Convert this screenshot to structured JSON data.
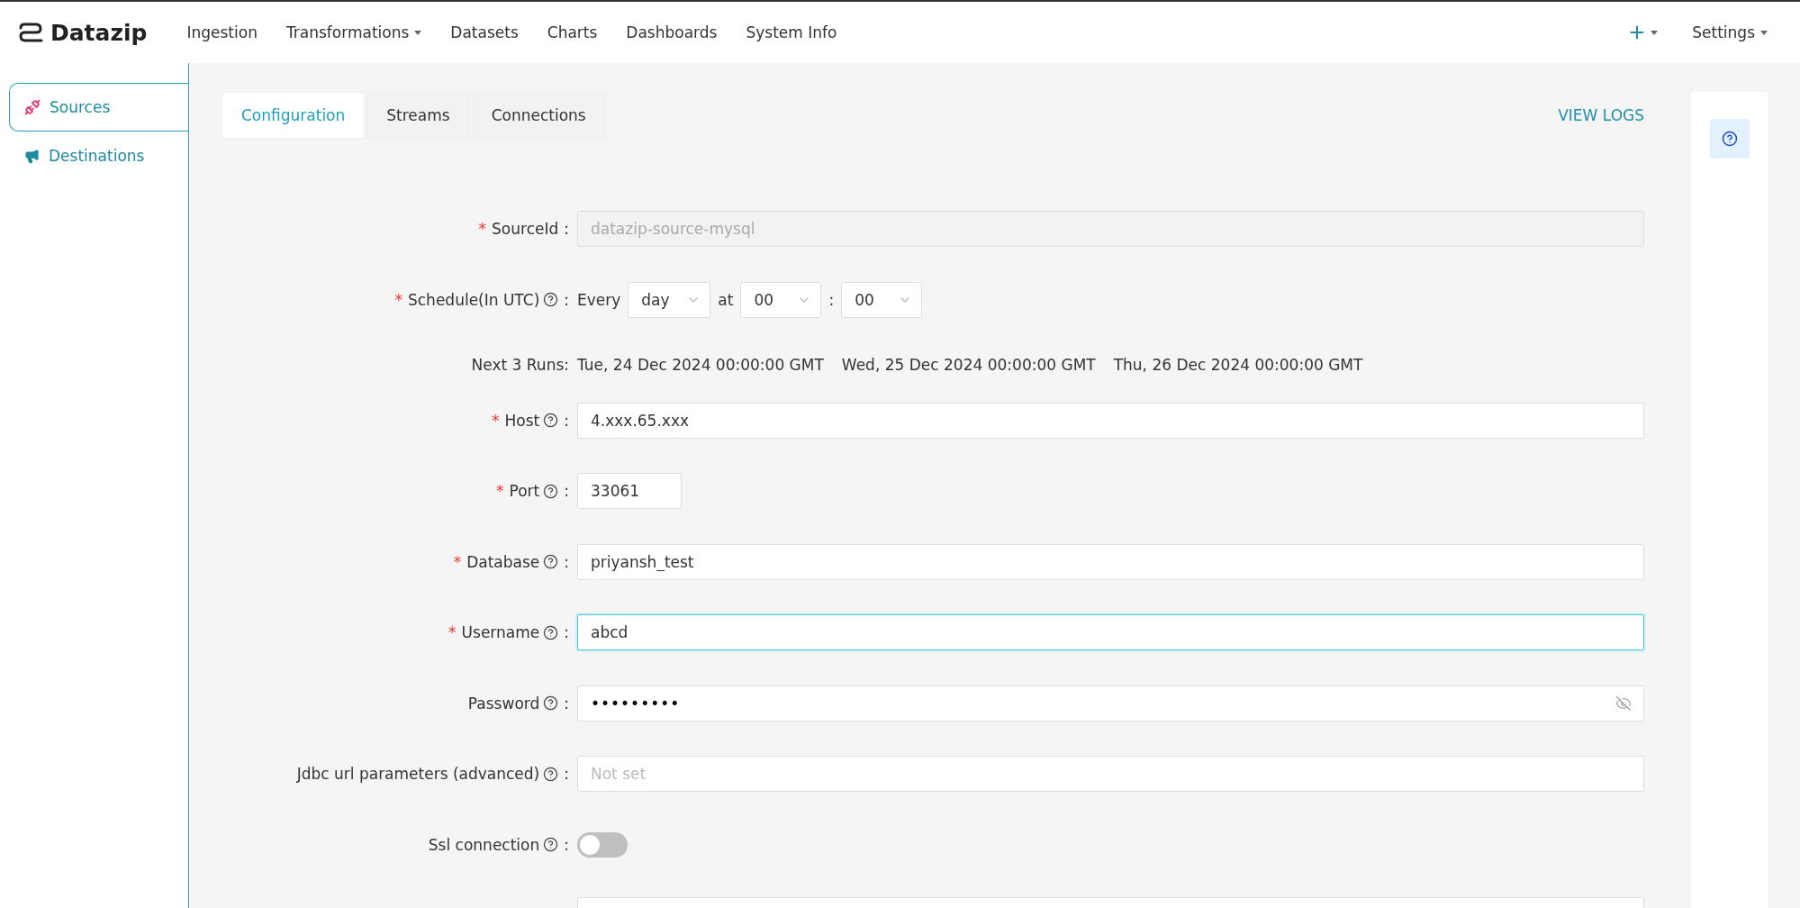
{
  "top_nav": {
    "brand": "Datazip",
    "items": [
      {
        "label": "Ingestion",
        "dropdown": false
      },
      {
        "label": "Transformations",
        "dropdown": true
      },
      {
        "label": "Datasets",
        "dropdown": false
      },
      {
        "label": "Charts",
        "dropdown": false
      },
      {
        "label": "Dashboards",
        "dropdown": false
      },
      {
        "label": "System Info",
        "dropdown": false
      }
    ],
    "settings": {
      "label": "Settings"
    }
  },
  "sidebar": {
    "items": [
      {
        "label": "Sources",
        "kind": "sources",
        "selected": true
      },
      {
        "label": "Destinations",
        "kind": "destinations",
        "selected": false
      }
    ]
  },
  "tabs": [
    {
      "label": "Configuration",
      "selected": true
    },
    {
      "label": "Streams",
      "selected": false
    },
    {
      "label": "Connections",
      "selected": false
    }
  ],
  "view_logs": "VIEW LOGS",
  "form": [
    {
      "kind": "text",
      "required_mark": "*",
      "label": "SourceId",
      "help": false,
      "colon": ":",
      "value": "datazip-source-mysql",
      "disabled": true
    },
    {
      "kind": "schedule",
      "required_mark": "*",
      "label": "Schedule(In UTC)",
      "help": true,
      "colon": ":",
      "every": "Every",
      "period": "day",
      "at": "at",
      "hour": "00",
      "separator": ":",
      "minute": "00"
    },
    {
      "kind": "runs",
      "label": "Next 3 Runs:",
      "runs": [
        "Tue, 24 Dec 2024 00:00:00 GMT",
        "Wed, 25 Dec 2024 00:00:00 GMT",
        "Thu, 26 Dec 2024 00:00:00 GMT"
      ]
    },
    {
      "kind": "text",
      "required_mark": "*",
      "label": "Host",
      "help": true,
      "colon": ":",
      "value": "4.xxx.65.xxx",
      "disabled": false
    },
    {
      "kind": "short",
      "required_mark": "*",
      "label": "Port",
      "help": true,
      "colon": ":",
      "value": "33061"
    },
    {
      "kind": "text",
      "required_mark": "*",
      "label": "Database",
      "help": true,
      "colon": ":",
      "value": "priyansh_test",
      "disabled": false
    },
    {
      "kind": "text",
      "required_mark": "*",
      "label": "Username",
      "help": true,
      "colon": ":",
      "value": "abcd",
      "disabled": false,
      "focused": true
    },
    {
      "kind": "password",
      "label": "Password",
      "help": true,
      "colon": ":",
      "value": "•••••••••"
    },
    {
      "kind": "text",
      "label": "Jdbc url parameters (advanced)",
      "help": true,
      "colon": ":",
      "placeholder": "Not set",
      "disabled": false
    },
    {
      "kind": "toggle",
      "label": "Ssl connection",
      "help": true,
      "colon": ":",
      "on": false
    },
    {
      "kind": "partial"
    }
  ]
}
